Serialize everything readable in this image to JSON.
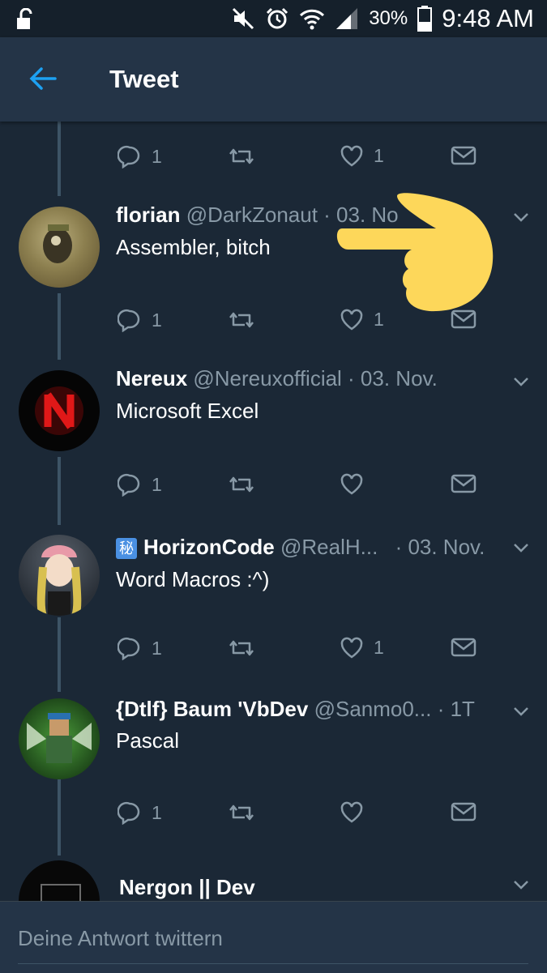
{
  "status_bar": {
    "battery": "30%",
    "time": "9:48 AM"
  },
  "header": {
    "title": "Tweet"
  },
  "tweets": [
    {
      "actions": {
        "reply": "1",
        "retweet": "",
        "like": "1"
      }
    },
    {
      "name": "florian",
      "handle": "@DarkZonaut · 03. No",
      "text": "Assembler, bitch",
      "actions": {
        "reply": "1",
        "retweet": "",
        "like": "1"
      }
    },
    {
      "name": "Nereux",
      "handle": "@Nereuxofficial · 03. Nov.",
      "text": "Microsoft Excel",
      "actions": {
        "reply": "1",
        "retweet": "",
        "like": ""
      }
    },
    {
      "badge": "秘",
      "name": "HorizonCode",
      "handle": "@RealH...",
      "date": "· 03. Nov.",
      "text": "Word Macros :^)",
      "actions": {
        "reply": "1",
        "retweet": "",
        "like": "1"
      }
    },
    {
      "name": "{Dtlf} Baum 'VbDev",
      "handle": "@Sanmo0... · 1T",
      "text": "Pascal",
      "actions": {
        "reply": "1",
        "retweet": "",
        "like": ""
      }
    },
    {
      "name": "Nergon || Dev"
    }
  ],
  "reply": {
    "placeholder": "Deine Antwort twittern"
  }
}
